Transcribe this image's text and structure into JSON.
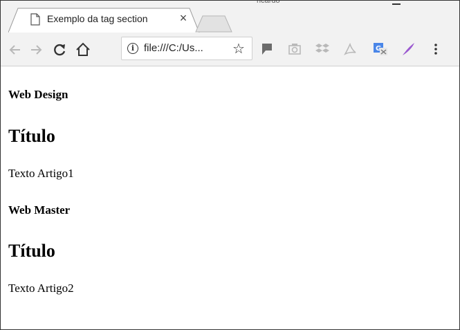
{
  "browser": {
    "tab_title": "Exemplo da tag section",
    "close_glyph": "×",
    "url_display": "file:///C:/Us...",
    "title_fragment": "ricardo"
  },
  "page": {
    "sections": [
      {
        "heading": "Web Design",
        "article_title": "Título",
        "article_text": "Texto Artigo1"
      },
      {
        "heading": "Web Master",
        "article_title": "Título",
        "article_text": "Texto Artigo2"
      }
    ]
  },
  "icons": {
    "tab": "page-icon",
    "back": "back-arrow-icon",
    "forward": "forward-arrow-icon",
    "reload": "reload-icon",
    "home": "home-icon",
    "info": "info-icon",
    "bookmark": "star-icon",
    "extensions": [
      "flag-icon",
      "camera-icon",
      "dropbox-icon",
      "acrobat-icon",
      "translate-icon",
      "quill-icon"
    ],
    "menu": "kebab-menu-icon"
  },
  "colors": {
    "chrome_bg": "#f2f2f2",
    "text": "#000000",
    "translate_blue": "#4a86e8",
    "quill_purple": "#9b59d0"
  }
}
